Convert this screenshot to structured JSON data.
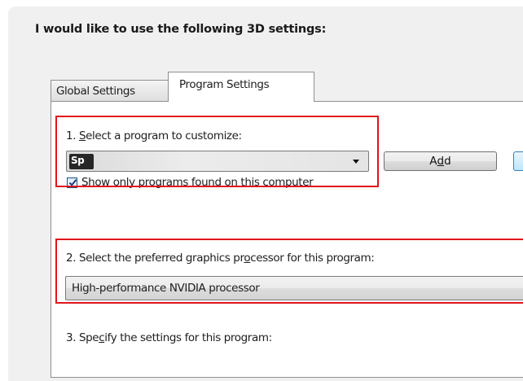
{
  "header": {
    "title": "I would like to use the following 3D settings:"
  },
  "tabs": [
    {
      "label": "Global Settings",
      "active": false
    },
    {
      "label": "Program Settings",
      "active": true
    }
  ],
  "step1": {
    "label_prefix": "1. ",
    "label_accel": "S",
    "label_rest": "elect a program to customize:",
    "program_icon_text": "Sp",
    "add_button": {
      "label_prefix": "A",
      "label_accel": "d",
      "label_rest": "d"
    }
  },
  "show_only_checkbox": {
    "checked": true,
    "label_prefix": "Show only progra",
    "label_accel": "m",
    "label_rest": "s found on this computer"
  },
  "step2": {
    "label_prefix": "2. Select the preferred graphics pr",
    "label_accel": "o",
    "label_rest": "cessor for this program:",
    "selected_value": "High-performance NVIDIA processor"
  },
  "step3": {
    "label_prefix": "3. Spe",
    "label_accel": "c",
    "label_rest": "ify the settings for this program:"
  },
  "colors": {
    "highlight_box": "#e0141c",
    "checkbox_border": "#1c5180",
    "accent_blue": "#3c7fb1"
  }
}
